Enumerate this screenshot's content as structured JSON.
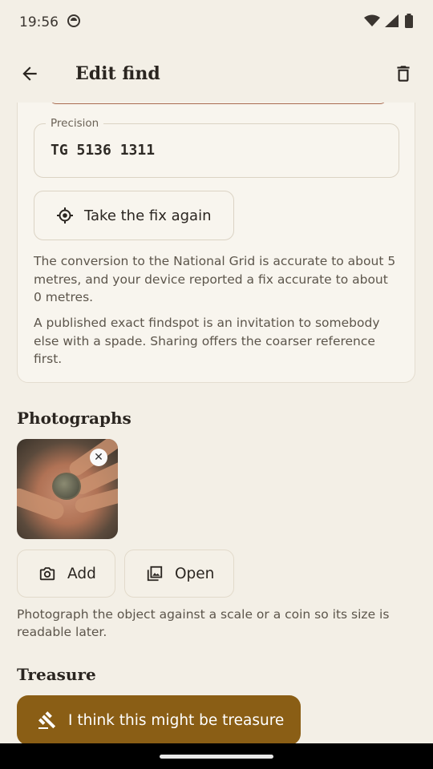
{
  "status_bar": {
    "time": "19:56"
  },
  "app_bar": {
    "title": "Edit find"
  },
  "location_card": {
    "precision_label": "Precision",
    "precision_value": "TG 5136 1311",
    "fix_button_label": "Take the fix again",
    "note_accuracy": "The conversion to the National Grid is accurate to about 5 metres, and your device reported a fix accurate to about 0 metres.",
    "note_sharing": "A published exact findspot is an invitation to somebody else with a spade. Sharing offers the coarser reference first."
  },
  "photographs": {
    "title": "Photographs",
    "add_label": "Add",
    "open_label": "Open",
    "hint": "Photograph the object against a scale or a coin so its size is readable later."
  },
  "treasure": {
    "title": "Treasure",
    "button_label": "I think this might be treasure"
  },
  "colors": {
    "background": "#f3efe6",
    "accent": "#8a5e15"
  }
}
